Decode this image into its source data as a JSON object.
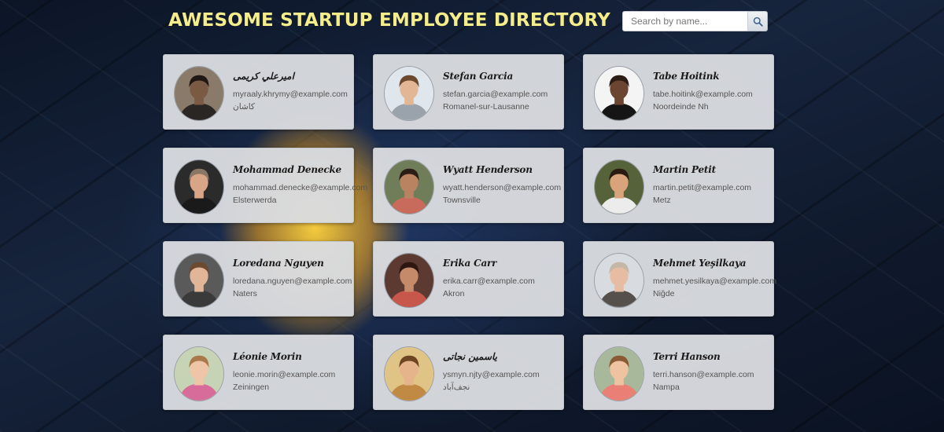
{
  "header": {
    "title": "AWESOME STARTUP EMPLOYEE DIRECTORY",
    "title_color": "#f5ec8a"
  },
  "search": {
    "placeholder": "Search by name...",
    "value": "",
    "button_icon": "search-icon"
  },
  "employees": [
    {
      "name": "اميرعلي كريمی",
      "email": "myraaly.khrymy@example.com",
      "city": "کاشان",
      "avatar": {
        "bg": "#8a7a6a",
        "skin": "#7a5a42",
        "hair": "#1e1714",
        "shirt": "#2a2623"
      }
    },
    {
      "name": "Stefan Garcia",
      "email": "stefan.garcia@example.com",
      "city": "Romanel-sur-Lausanne",
      "avatar": {
        "bg": "#dfe6ec",
        "skin": "#e2b796",
        "hair": "#6b4a2e",
        "shirt": "#9aa3ab"
      }
    },
    {
      "name": "Tabe Hoitink",
      "email": "tabe.hoitink@example.com",
      "city": "Noordeinde Nh",
      "avatar": {
        "bg": "#f4f4f4",
        "skin": "#6b4532",
        "hair": "#2b1c15",
        "shirt": "#151515"
      }
    },
    {
      "name": "Mohammad Denecke",
      "email": "mohammad.denecke@example.com",
      "city": "Elsterwerda",
      "avatar": {
        "bg": "#2b2b2b",
        "skin": "#d8a686",
        "hair": "#8a7665",
        "shirt": "#1a1a1a"
      }
    },
    {
      "name": "Wyatt Henderson",
      "email": "wyatt.henderson@example.com",
      "city": "Townsville",
      "avatar": {
        "bg": "#6f7d58",
        "skin": "#b98361",
        "hair": "#2a1d15",
        "shirt": "#c86a5c"
      }
    },
    {
      "name": "Martin Petit",
      "email": "martin.petit@example.com",
      "city": "Metz",
      "avatar": {
        "bg": "#56623a",
        "skin": "#d9a47c",
        "hair": "#2a1a10",
        "shirt": "#ececec"
      }
    },
    {
      "name": "Loredana Nguyen",
      "email": "loredana.nguyen@example.com",
      "city": "Naters",
      "avatar": {
        "bg": "#5a5a5a",
        "skin": "#e1b597",
        "hair": "#6b4a30",
        "shirt": "#3a3a3a"
      }
    },
    {
      "name": "Erika Carr",
      "email": "erika.carr@example.com",
      "city": "Akron",
      "avatar": {
        "bg": "#5c3a32",
        "skin": "#c48a6a",
        "hair": "#2c1810",
        "shirt": "#c7574a"
      }
    },
    {
      "name": "Mehmet Yeşilkaya",
      "email": "mehmet.yesilkaya@example.com",
      "city": "Niğde",
      "avatar": {
        "bg": "#d8dbdf",
        "skin": "#e6bda3",
        "hair": "#c5b7a7",
        "shirt": "#55504b"
      }
    },
    {
      "name": "Léonie Morin",
      "email": "leonie.morin@example.com",
      "city": "Zeiningen",
      "avatar": {
        "bg": "#c6d3b4",
        "skin": "#eec5a6",
        "hair": "#a9794c",
        "shirt": "#d76b9a"
      }
    },
    {
      "name": "ياسمين نجاتی",
      "email": "ysmyn.njty@example.com",
      "city": "نجف‌آباد",
      "avatar": {
        "bg": "#e0c486",
        "skin": "#e6b48b",
        "hair": "#6e4522",
        "shirt": "#c08a45"
      }
    },
    {
      "name": "Terri Hanson",
      "email": "terri.hanson@example.com",
      "city": "Nampa",
      "avatar": {
        "bg": "#a7b99a",
        "skin": "#efc3a2",
        "hair": "#8a5a34",
        "shirt": "#ea7f76"
      }
    }
  ]
}
